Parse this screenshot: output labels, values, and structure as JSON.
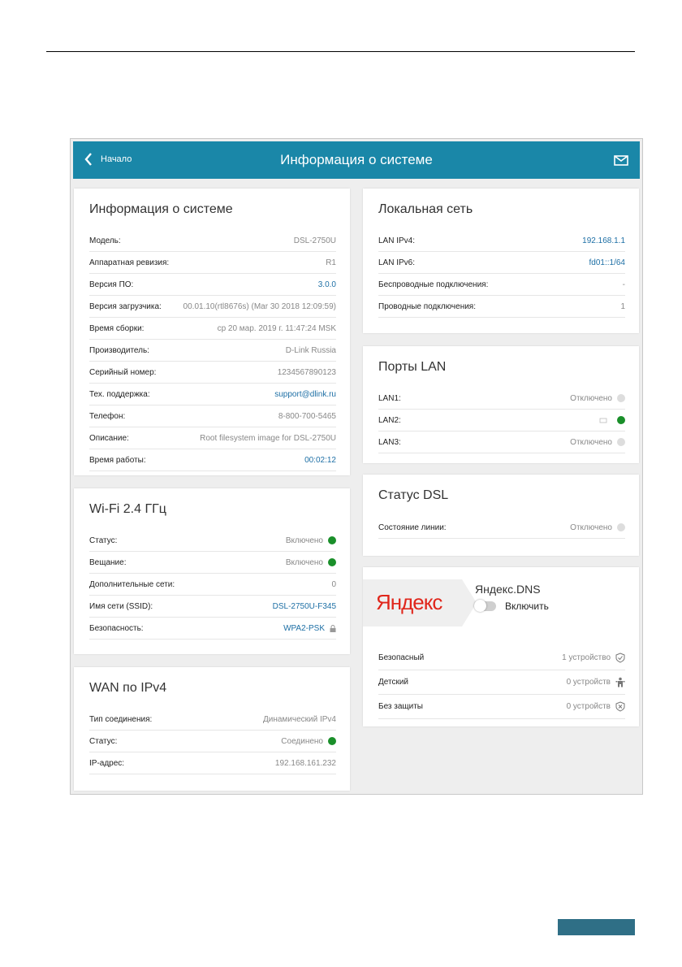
{
  "header": {
    "back_label": "Начало",
    "title": "Информация о системе"
  },
  "system_info": {
    "title": "Информация о системе",
    "rows": [
      {
        "label": "Модель:",
        "value": "DSL-2750U",
        "link": false
      },
      {
        "label": "Аппаратная ревизия:",
        "value": "R1",
        "link": false
      },
      {
        "label": "Версия ПО:",
        "value": "3.0.0",
        "link": true
      },
      {
        "label": "Версия загрузчика:",
        "value": "00.01.10(rtl8676s) (Mar 30 2018 12:09:59)",
        "link": false
      },
      {
        "label": "Время сборки:",
        "value": "ср 20 мар. 2019 г. 11:47:24 MSK",
        "link": false
      },
      {
        "label": "Производитель:",
        "value": "D-Link Russia",
        "link": false
      },
      {
        "label": "Серийный номер:",
        "value": "1234567890123",
        "link": false
      },
      {
        "label": "Тех. поддержка:",
        "value": "support@dlink.ru",
        "link": true
      },
      {
        "label": "Телефон:",
        "value": "8-800-700-5465",
        "link": false
      },
      {
        "label": "Описание:",
        "value": "Root filesystem image for DSL-2750U",
        "link": false
      },
      {
        "label": "Время работы:",
        "value": "00:02:12",
        "link": true
      }
    ]
  },
  "wifi": {
    "title": "Wi-Fi 2.4 ГГц",
    "rows": [
      {
        "label": "Статус:",
        "value": "Включено",
        "status": "on"
      },
      {
        "label": "Вещание:",
        "value": "Включено",
        "status": "on"
      },
      {
        "label": "Дополнительные сети:",
        "value": "0"
      },
      {
        "label": "Имя сети (SSID):",
        "value": "DSL-2750U-F345",
        "link": true
      },
      {
        "label": "Безопасность:",
        "value": "WPA2-PSK",
        "link": true,
        "icon": "lock-icon"
      }
    ]
  },
  "wan": {
    "title": "WAN по IPv4",
    "rows": [
      {
        "label": "Тип соединения:",
        "value": "Динамический IPv4"
      },
      {
        "label": "Статус:",
        "value": "Соединено",
        "status": "on"
      },
      {
        "label": "IP-адрес:",
        "value": "192.168.161.232"
      }
    ]
  },
  "lan": {
    "title": "Локальная сеть",
    "rows": [
      {
        "label": "LAN IPv4:",
        "value": "192.168.1.1",
        "link": true
      },
      {
        "label": "LAN IPv6:",
        "value": "fd01::1/64",
        "link": true
      },
      {
        "label": "Беспроводные подключения:",
        "value": "-"
      },
      {
        "label": "Проводные подключения:",
        "value": "1"
      }
    ]
  },
  "lan_ports": {
    "title": "Порты LAN",
    "rows": [
      {
        "label": "LAN1:",
        "value": "Отключено",
        "status": "off"
      },
      {
        "label": "LAN2:",
        "value": "",
        "status": "on",
        "icon": "port-duplex-icon"
      },
      {
        "label": "LAN3:",
        "value": "Отключено",
        "status": "off"
      }
    ]
  },
  "dsl": {
    "title": "Статус DSL",
    "rows": [
      {
        "label": "Состояние линии:",
        "value": "Отключено",
        "status": "off"
      }
    ]
  },
  "yandex": {
    "logo": "Яндекс",
    "dns_title": "Яндекс.DNS",
    "toggle_label": "Включить",
    "toggle_on": false,
    "rows": [
      {
        "label": "Безопасный",
        "value": "1 устройство",
        "icon": "shield-check-icon"
      },
      {
        "label": "Детский",
        "value": "0 устройств",
        "icon": "child-icon"
      },
      {
        "label": "Без защиты",
        "value": "0 устройств",
        "icon": "shield-x-icon"
      }
    ]
  },
  "colors": {
    "header": "#1a87a8",
    "link": "#1d6fa5",
    "status_on": "#1a8f2a",
    "status_off": "#dddddd",
    "yandex_red": "#e0261b"
  }
}
